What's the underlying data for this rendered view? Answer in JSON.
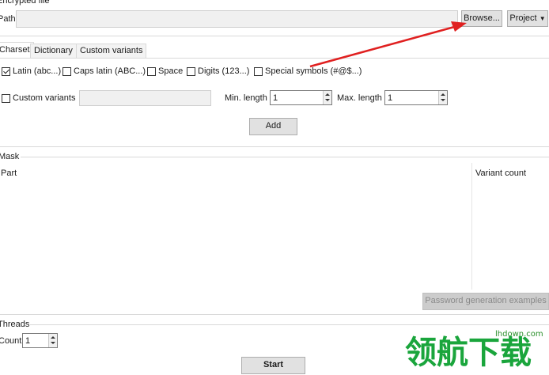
{
  "encrypted_file": {
    "group_title": "Encrypted file",
    "path_label": "Path",
    "path_value": "",
    "browse_label": "Browse...",
    "project_label": "Project"
  },
  "tabs": [
    {
      "label": "Charset",
      "active": true
    },
    {
      "label": "Dictionary",
      "active": false
    },
    {
      "label": "Custom variants",
      "active": false
    }
  ],
  "charset": {
    "options": [
      {
        "label": "Latin (abc...)",
        "checked": true
      },
      {
        "label": "Caps latin (ABC...)",
        "checked": false
      },
      {
        "label": "Space",
        "checked": false
      },
      {
        "label": "Digits (123...)",
        "checked": false
      },
      {
        "label": "Special symbols (#@$...)",
        "checked": false
      }
    ],
    "custom_variants_label": "Custom variants",
    "custom_variants_checked": false,
    "custom_variants_value": "",
    "min_length_label": "Min. length",
    "min_length_value": "1",
    "max_length_label": "Max. length",
    "max_length_value": "1",
    "add_label": "Add"
  },
  "mask": {
    "group_title": "Mask",
    "col_part": "Part",
    "col_variant_count": "Variant count",
    "examples_label": "Password generation examples"
  },
  "threads": {
    "group_title": "Threads",
    "count_label": "Count",
    "count_value": "1"
  },
  "start_label": "Start",
  "watermark": {
    "site": "lhdown.com",
    "cn_text": "领航下载",
    "color": "#1aa53c"
  },
  "annotation_color": "#e02020"
}
